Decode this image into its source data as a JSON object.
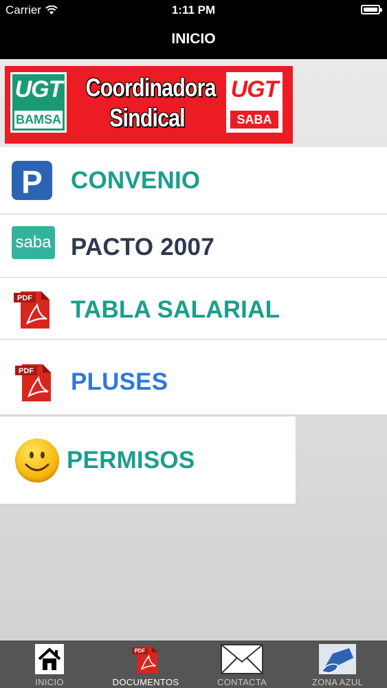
{
  "status_bar": {
    "carrier": "Carrier",
    "time": "1:11 PM"
  },
  "nav": {
    "title": "INICIO"
  },
  "banner": {
    "left_logo": {
      "top": "UGT",
      "bottom": "BAMSA"
    },
    "title_line1": "Coordinadora",
    "title_line2": "Sindical",
    "right_logo": {
      "top": "UGT",
      "bottom": "SABA"
    }
  },
  "menu": {
    "items": [
      {
        "label": "CONVENIO",
        "icon": "parking-icon",
        "color": "#1a9e8c"
      },
      {
        "label": "PACTO 2007",
        "icon": "saba-logo-icon",
        "icon_text": "saba",
        "color": "#2e3a4c"
      },
      {
        "label": "TABLA SALARIAL",
        "icon": "pdf-icon",
        "color": "#1a9e8c"
      },
      {
        "label": "PLUSES",
        "icon": "pdf-icon",
        "color": "#2f78d8"
      },
      {
        "label": "PERMISOS",
        "icon": "smiley-icon",
        "color": "#1a9e8c"
      }
    ]
  },
  "tab_bar": {
    "tabs": [
      {
        "label": "INICIO",
        "icon": "home-icon",
        "active": false
      },
      {
        "label": "DOCUMENTOS",
        "icon": "pdf-icon",
        "active": true
      },
      {
        "label": "CONTACTA",
        "icon": "envelope-icon",
        "active": false
      },
      {
        "label": "ZONA AZUL",
        "icon": "hand-card-icon",
        "active": false
      }
    ]
  }
}
